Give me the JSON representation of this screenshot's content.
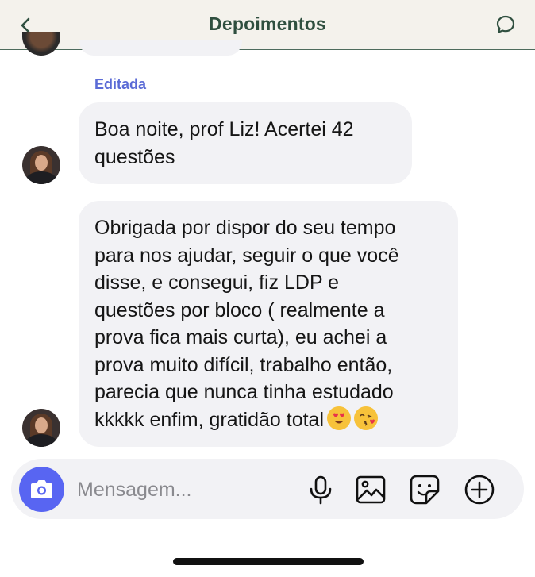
{
  "header": {
    "title": "Depoimentos",
    "back_icon": "chevron-left-icon",
    "chat_icon": "chat-bubble-icon"
  },
  "messages": [
    {
      "edited_label": "Editada",
      "lines": [
        "Boa noite, prof Liz! Acertei 42",
        "questões"
      ]
    },
    {
      "lines": [
        "Obrigada por dispor do seu tempo",
        "para nos ajudar, seguir o que você",
        "disse, e consegui, fiz LDP e",
        "questões por bloco ( realmente a",
        "prova fica mais curta), eu achei a",
        "prova muito difícil, trabalho então,",
        "parecia que nunca tinha estudado",
        "kkkkk enfim, gratidão total"
      ],
      "emojis": [
        "😍",
        "😘"
      ]
    }
  ],
  "composer": {
    "placeholder": "Mensagem...",
    "icons": [
      "camera-icon",
      "microphone-icon",
      "image-icon",
      "sticker-icon",
      "plus-circle-icon"
    ]
  },
  "colors": {
    "header_title": "#2f4f3f",
    "edited_label": "#5b6bd6",
    "bubble_bg": "#f2f2f5",
    "camera_bg": "#5865f2"
  }
}
